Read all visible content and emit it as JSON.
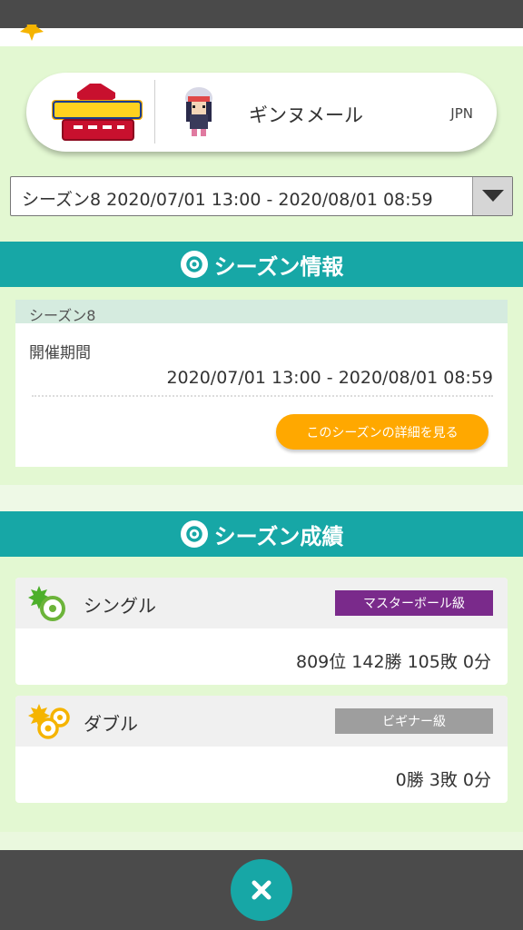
{
  "profile": {
    "game_logo_text": "ポケットモンスター シールド",
    "player_name": "ギンヌメール",
    "region": "JPN"
  },
  "season_select": {
    "selected": "シーズン8 2020/07/01 13:00 - 2020/08/01 08:59"
  },
  "season_info": {
    "header": "シーズン情報",
    "season_label": "シーズン8",
    "period_title": "開催期間",
    "period_value": "2020/07/01 13:00 - 2020/08/01 08:59",
    "detail_button": "このシーズンの詳細を見る"
  },
  "season_results": {
    "header": "シーズン成績",
    "single": {
      "name": "シングル",
      "rank_badge": "マスターボール級",
      "badge_color": "#7a2a8b",
      "stats": "809位 142勝 105敗 0分"
    },
    "double": {
      "name": "ダブル",
      "rank_badge": "ビギナー級",
      "badge_color": "#9e9e9e",
      "stats": "0勝 3敗 0分"
    }
  },
  "colors": {
    "teal": "#17a7a6",
    "orange": "#ffa800",
    "background": "#e3f8d2"
  }
}
